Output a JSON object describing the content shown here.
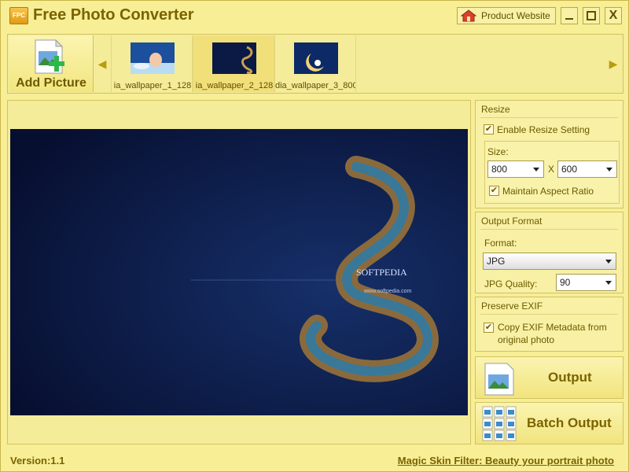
{
  "app": {
    "logo_text": "FPC",
    "title": "Free Photo Converter"
  },
  "titlebar": {
    "product_website": "Product Website",
    "minimize": "—",
    "maximize": "☐",
    "close": "X"
  },
  "strip": {
    "add_picture": "Add Picture",
    "prev_arrow": "◀",
    "next_arrow": "▶",
    "thumbnails": [
      {
        "label": "ia_wallpaper_1_128"
      },
      {
        "label": "ia_wallpaper_2_128"
      },
      {
        "label": "dia_wallpaper_3_800"
      }
    ]
  },
  "resize": {
    "title": "Resize",
    "enable_label": "Enable Resize Setting",
    "enable_checked": true,
    "size_label": "Size:",
    "width": "800",
    "x_sep": "X",
    "height": "600",
    "maintain_label": "Maintain Aspect Ratio",
    "maintain_checked": true
  },
  "output_format": {
    "title": "Output Format",
    "format_label": "Format:",
    "format_value": "JPG",
    "quality_label": "JPG Quality:",
    "quality_value": "90"
  },
  "exif": {
    "title": "Preserve EXIF",
    "copy_label_line1": "Copy EXIF Metadata from",
    "copy_label_line2": "original photo",
    "copy_checked": true
  },
  "buttons": {
    "output": "Output",
    "batch_output": "Batch Output"
  },
  "preview": {
    "watermark": "SOFTPEDIA",
    "url_text": "www.softpedia.com"
  },
  "status": {
    "version": "Version:1.1",
    "magic_link": "Magic Skin Filter: Beauty your portrait photo"
  },
  "checkmark": "✔"
}
